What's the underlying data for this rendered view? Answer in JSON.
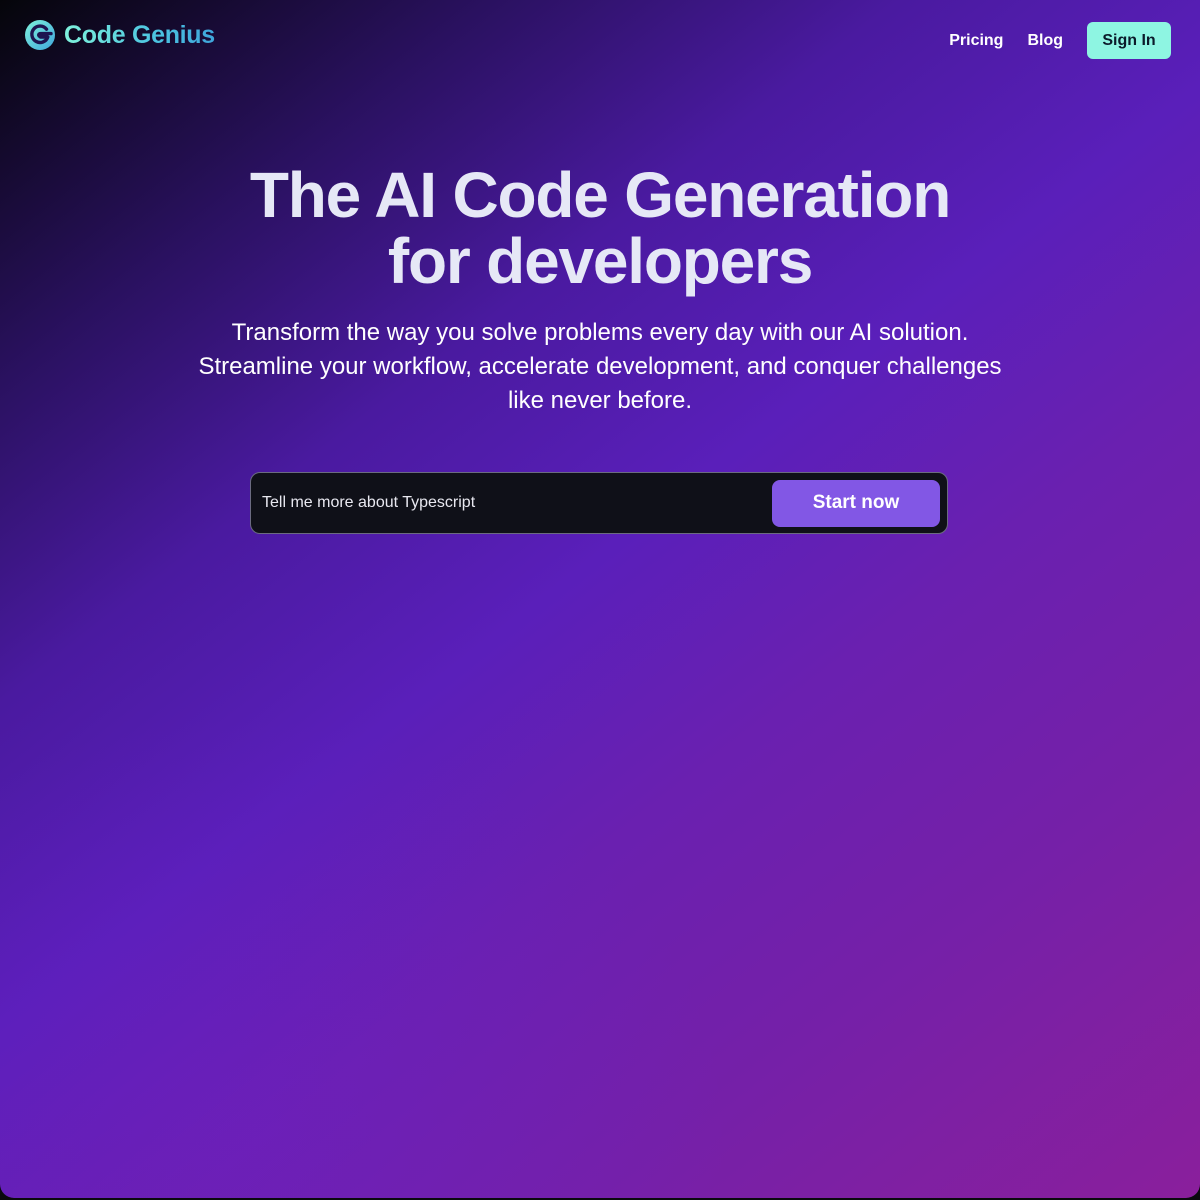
{
  "brand": {
    "name": "Code Genius",
    "logo_icon": "code-genius-logo-icon",
    "gradient_start": "#7ff2dc",
    "gradient_end": "#3fa6dc"
  },
  "nav": {
    "links": [
      {
        "label": "Pricing"
      },
      {
        "label": "Blog"
      }
    ],
    "signin_label": "Sign In",
    "signin_color": "#8ef5e2"
  },
  "hero": {
    "title_lines": [
      "The AI Code Generation",
      "for developers"
    ],
    "subtitle_lines": [
      "Transform the way you solve problems every day with our AI solution.",
      "Streamline your workflow, accelerate development, and conquer challenges",
      "like never before."
    ]
  },
  "prompt": {
    "value": "Tell me more about Typescript",
    "button_label": "Start now",
    "button_color": "#8257e5"
  },
  "theme": {
    "background_dark": "#05050a",
    "background_purple": "#5a1fba",
    "background_magenta": "#8a1f9c"
  }
}
